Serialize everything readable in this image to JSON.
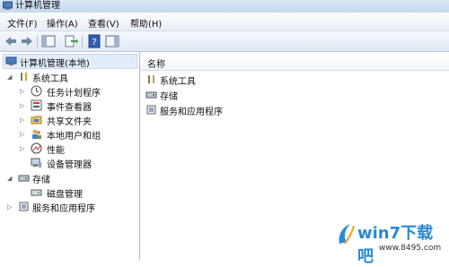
{
  "window": {
    "title": "计算机管理"
  },
  "menu": [
    "文件(F)",
    "操作(A)",
    "查看(V)",
    "帮助(H)"
  ],
  "toolbar": {
    "buttons": [
      "back-icon",
      "forward-icon",
      "show-tree-icon",
      "export-list-icon",
      "help-icon",
      "action-pane-icon"
    ]
  },
  "tree": {
    "root": "计算机管理(本地)",
    "system_tools": "系统工具",
    "system_tools_children": [
      "任务计划程序",
      "事件查看器",
      "共享文件夹",
      "本地用户和组",
      "性能",
      "设备管理器"
    ],
    "storage": "存储",
    "storage_children": [
      "磁盘管理"
    ],
    "services": "服务和应用程序"
  },
  "list": {
    "header": "名称",
    "items": [
      "系统工具",
      "存储",
      "服务和应用程序"
    ]
  },
  "watermark": {
    "text": "win7下载吧",
    "url": "www.8495.com"
  }
}
